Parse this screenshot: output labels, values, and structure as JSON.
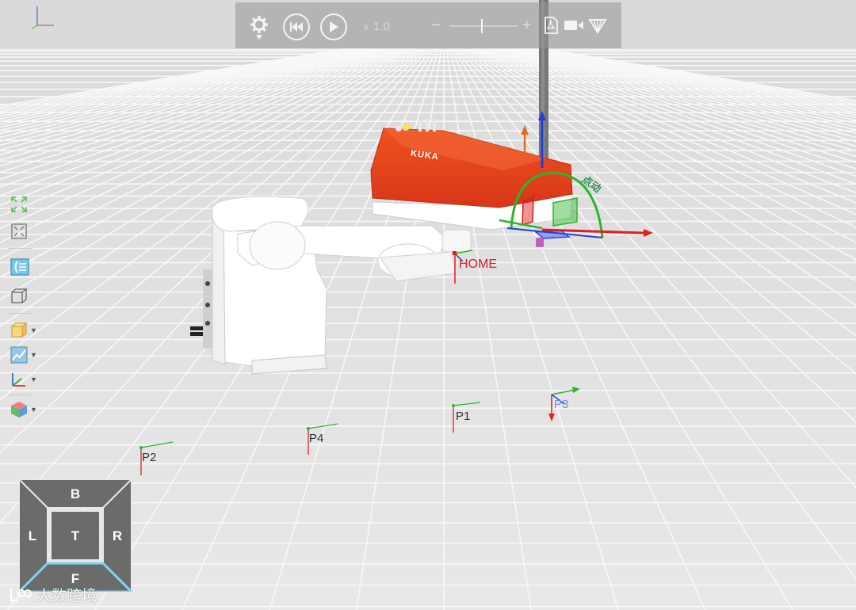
{
  "toolbar": {
    "speed_prefix": "x",
    "speed_value": "1.0",
    "buttons": [
      "settings",
      "rewind",
      "play",
      "zoom-out",
      "zoom-in",
      "export-pdf",
      "record-video",
      "more-tools"
    ]
  },
  "scene": {
    "home_label": "HOME",
    "move_label": "点动",
    "brand": "KUKA",
    "points": [
      "P1",
      "P2",
      "P3",
      "P4"
    ]
  },
  "left_toolbar": {
    "tools": [
      "fit-view",
      "shrink-view",
      "camera",
      "wireframe",
      "box",
      "chart",
      "axes",
      "color"
    ]
  },
  "viewcube": {
    "top": "T",
    "bottom": "B",
    "left": "L",
    "right": "R",
    "front": "F"
  },
  "watermark": "大数跨境",
  "colors": {
    "robot_orange": "#e8401c",
    "axis_red": "#e02020",
    "axis_green": "#2db52d",
    "axis_blue": "#2040e0",
    "floor": "#e6e6e6",
    "grid": "#f7f7f7"
  }
}
